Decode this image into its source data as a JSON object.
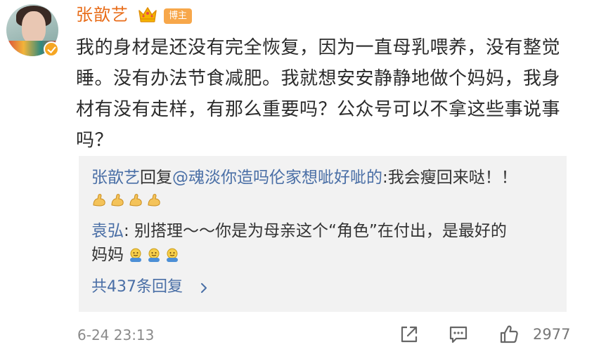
{
  "post": {
    "author": "张歆艺",
    "author_tag": "博主",
    "text": "我的身材是还没有完全恢复，因为一直母乳喂养，没有整觉睡。没有办法节食减肥。我就想安安静静地做个妈妈，我身材有没有走样，有那么重要吗？公众号可以不拿这些事说事吗？",
    "timestamp": "6-24 23:13",
    "like_count": "2977"
  },
  "replies": [
    {
      "author": "张歆艺",
      "action": "回复",
      "target": "@魂淡你造吗伦家想呲好呲的",
      "text": ":我会瘦回来哒！！",
      "emojis": [
        "flexed-biceps-emoji",
        "flexed-biceps-emoji",
        "flexed-biceps-emoji",
        "flexed-biceps-emoji"
      ]
    },
    {
      "author": "袁弘",
      "text_line1": ": 别搭理～～你是为母亲这个“角色”在付出，是最好的",
      "text_line2": "妈妈",
      "emojis": [
        "hug-emoji",
        "hug-emoji",
        "hug-emoji"
      ]
    }
  ],
  "more_replies": "共437条回复",
  "colors": {
    "username": "#e86d1a",
    "link_blue": "#4a6fa6",
    "tag_bg": "#f7a74a",
    "reply_bg": "#f2f2f2"
  },
  "icons": {
    "crown": "crown-icon",
    "verified": "verified-badge-icon",
    "share": "share-icon",
    "comment": "comment-icon",
    "like": "thumbs-up-icon"
  }
}
